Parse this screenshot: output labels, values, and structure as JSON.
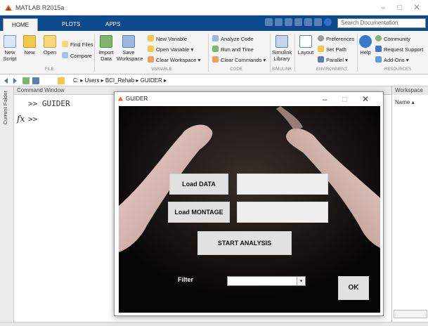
{
  "window": {
    "title": "MATLAB R2015a"
  },
  "tabs": [
    "HOME",
    "PLOTS",
    "APPS"
  ],
  "search": {
    "placeholder": "Search Documentation"
  },
  "ribbon": {
    "file": {
      "new_script": "New Script",
      "new": "New",
      "open": "Open",
      "find_files": "Find Files",
      "compare": "Compare",
      "group": "FILE"
    },
    "variable": {
      "import_data": "Import Data",
      "save_workspace": "Save Workspace",
      "new_variable": "New Variable",
      "open_variable": "Open Variable",
      "clear_workspace": "Clear Workspace",
      "group": "VARIABLE"
    },
    "code": {
      "analyze_code": "Analyze Code",
      "run_and_time": "Run and Time",
      "clear_commands": "Clear Commands",
      "group": "CODE"
    },
    "simulink": {
      "simulink_library": "Simulink Library",
      "group": "SIMULINK"
    },
    "environment": {
      "layout": "Layout",
      "preferences": "Preferences",
      "set_path": "Set Path",
      "parallel": "Parallel",
      "group": "ENVIRONMENT"
    },
    "resources": {
      "help": "Help",
      "community": "Community",
      "request_support": "Request Support",
      "add_ons": "Add-Ons",
      "group": "RESOURCES"
    }
  },
  "address": {
    "crumbs": "C: ▸ Users ▸ BCI_Rehab ▸ GUIDER ▸"
  },
  "left_panel": {
    "label": "Current Folder"
  },
  "command_window": {
    "title": "Command Window",
    "lines": [
      ">> GUIDER",
      ">>"
    ],
    "fx": "fx"
  },
  "workspace": {
    "title": "Workspace",
    "name_col": "Name ▴"
  },
  "guider": {
    "title": "GUIDER",
    "load_data": "Load DATA",
    "load_montage": "Load MONTAGE",
    "start_analysis": "START ANALYSIS",
    "filter_label": "Filter",
    "filter_value": "",
    "ok": "OK"
  },
  "colors": {
    "tab_strip": "#0d4a8c",
    "matlab_logo": "#e06b1f"
  }
}
